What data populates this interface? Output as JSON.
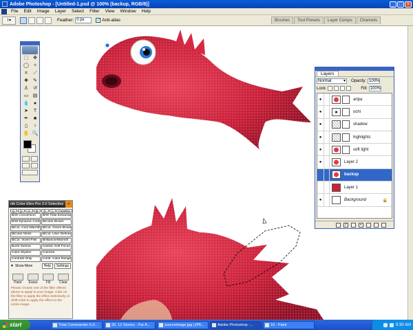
{
  "window": {
    "title": "Adobe Photoshop - [Untitled-1.psd @ 100% (backup, RGB/8)]",
    "buttons": [
      "_",
      "□",
      "×"
    ]
  },
  "menu": [
    "File",
    "Edit",
    "Image",
    "Layer",
    "Select",
    "Filter",
    "View",
    "Window",
    "Help"
  ],
  "options": {
    "feather_label": "Feather:",
    "feather_value": "0 px",
    "antialias_label": "Anti-alias",
    "antialias_checked": true,
    "palette_well_tabs": [
      "Brushes",
      "Tool Presets",
      "Layer Comps",
      "Channels"
    ]
  },
  "tools": [
    "marquee",
    "move",
    "lasso",
    "magic-wand",
    "crop",
    "slice",
    "healing",
    "brush",
    "stamp",
    "history-brush",
    "eraser",
    "gradient",
    "blur",
    "dodge",
    "path-select",
    "type",
    "pen",
    "shape",
    "notes",
    "eyedropper",
    "hand",
    "zoom"
  ],
  "layers_panel": {
    "tab": "Layers",
    "blend_mode": "Normal",
    "opacity_label": "Opacity:",
    "opacity_value": "100%",
    "lock_label": "Lock:",
    "fill_label": "Fill:",
    "fill_value": "100%",
    "layers": [
      {
        "name": "aripa",
        "visible": true,
        "thumb": "red",
        "mask": true,
        "selected": false
      },
      {
        "name": "ochi",
        "visible": true,
        "thumb": "eye-th",
        "mask": true,
        "selected": false
      },
      {
        "name": "shadow",
        "visible": true,
        "thumb": "checker",
        "mask": true,
        "selected": false
      },
      {
        "name": "highlights",
        "visible": true,
        "thumb": "checker",
        "mask": true,
        "selected": false
      },
      {
        "name": "soft light",
        "visible": true,
        "thumb": "red",
        "mask": true,
        "selected": false
      },
      {
        "name": "Layer 2",
        "visible": true,
        "thumb": "red",
        "mask": false,
        "selected": false
      },
      {
        "name": "backup",
        "visible": false,
        "thumb": "red",
        "mask": false,
        "selected": true
      },
      {
        "name": "Layer 1",
        "visible": false,
        "thumb": "redfull",
        "mask": false,
        "selected": false
      },
      {
        "name": "Background",
        "visible": true,
        "thumb": "blank",
        "mask": false,
        "selected": false,
        "locked": true
      }
    ]
  },
  "nik": {
    "title": "nik Color Efex Pro 2.0 Selective",
    "tabs": [
      "A-C",
      "D-F",
      "G-L",
      "M-P",
      "R-S",
      "T-Z",
      "Favorites"
    ],
    "filters": [
      "B/W Conversion",
      "B/W Total Extraction",
      "B/W Dynamic Contr.",
      "BiColor Brown",
      "BiCol. Cool Warmth",
      "BiCol. Green Brown",
      "BiColor Moss",
      "BiCol. User Defined",
      "BiCol. Violet Pink",
      "Brilliance/Warmth",
      "Burnt Sienna",
      "Classic Soft Focus",
      "Color Stylizer",
      "Colorize",
      "Contrast Only",
      "Contr. Color Range"
    ],
    "show_more": "Show More",
    "help": "Help",
    "settings": "Settings",
    "modes": [
      "Paint",
      "Erase",
      "Fill",
      "Clear"
    ],
    "help_text": "Please choose one of the filter effects above to apply to your image. Click on the filter to apply the effect selectively or Shift-Click to apply the effect to the entire image."
  },
  "taskbar": {
    "start": "start",
    "tasks": [
      "Total Commander 6.0...",
      "25. 12 Stories - Far A...",
      "sourceimage.jpg (JPE...",
      "Adobe Photoshop -...",
      "10 - Paint"
    ],
    "active_task": 3,
    "clock": "9:30 AM"
  }
}
